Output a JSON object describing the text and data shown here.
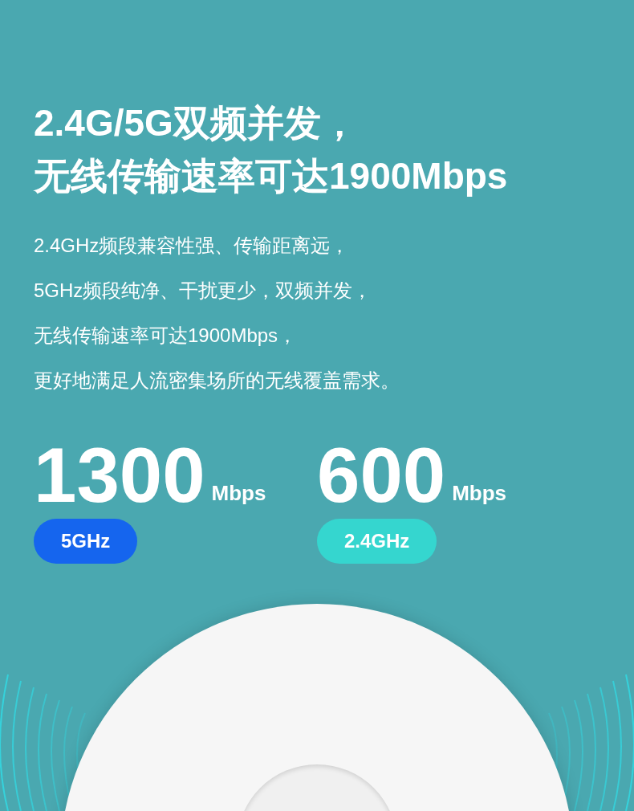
{
  "headline": [
    "2.4G/5G双频并发，",
    "无线传输速率可达1900Mbps"
  ],
  "description": [
    "2.4GHz频段兼容性强、传输距离远，",
    "5GHz频段纯净、干扰更少，双频并发，",
    "无线传输速率可达1900Mbps，",
    "更好地满足人流密集场所的无线覆盖需求。"
  ],
  "stats": [
    {
      "value": "1300",
      "unit": "Mbps",
      "band": "5GHz",
      "color": "#1565ee"
    },
    {
      "value": "600",
      "unit": "Mbps",
      "band": "2.4GHz",
      "color": "#35d6cf"
    }
  ]
}
